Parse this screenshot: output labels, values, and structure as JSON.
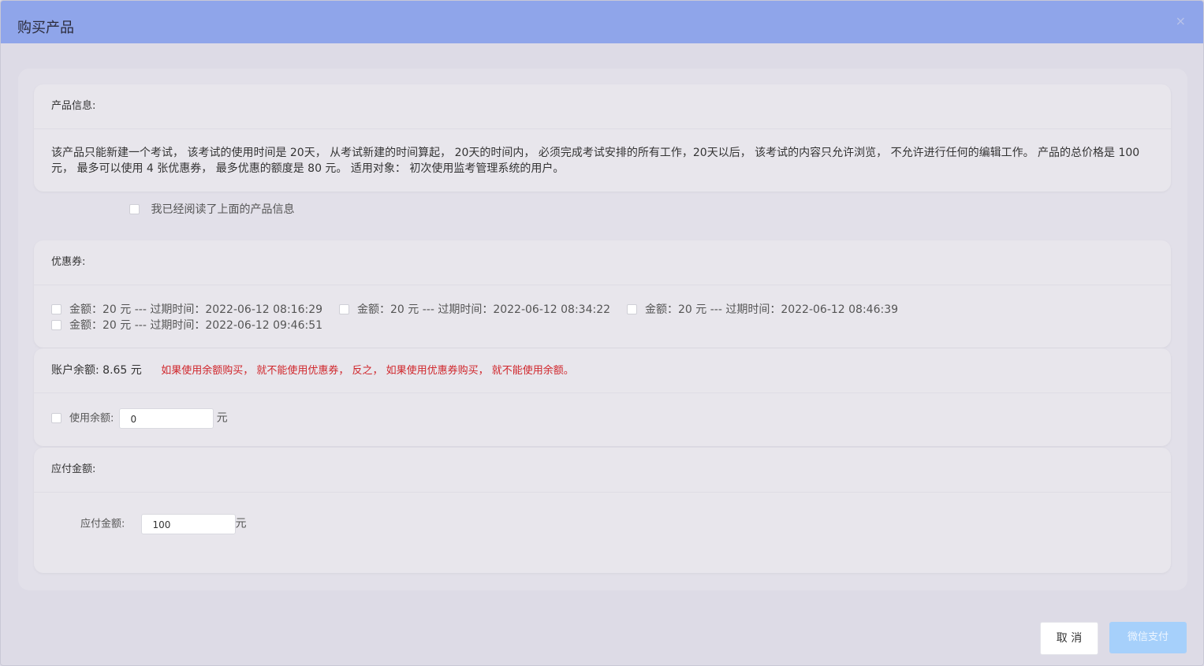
{
  "dialog": {
    "title": "购买产品",
    "close_icon": "×"
  },
  "product_info": {
    "heading": "产品信息:",
    "line1": "该产品只能新建一个考试， 该考试的使用时间是 20天， 从考试新建的时间算起， 20天的时间内， 必须完成考试安排的所有工作，20天以后， 该考试的内容只允许浏览， 不允许进行任何的编辑工作。 产品的总价格是 100",
    "line2": "元， 最多可以使用 4 张优惠券， 最多优惠的额度是 80 元。 适用对象： 初次使用监考管理系统的用户。",
    "read_confirm_label": "我已经阅读了上面的产品信息"
  },
  "coupons": {
    "heading": "优惠券:",
    "items": [
      {
        "label": "金额：20 元 --- 过期时间：2022-06-12 08:16:29"
      },
      {
        "label": "金额：20 元 --- 过期时间：2022-06-12 08:34:22"
      },
      {
        "label": "金额：20 元 --- 过期时间：2022-06-12 08:46:39"
      },
      {
        "label": "金额：20 元 --- 过期时间：2022-06-12 09:46:51"
      }
    ]
  },
  "balance": {
    "heading": "账户余额: 8.65 元",
    "warning": "如果使用余额购买， 就不能使用优惠券， 反之， 如果使用优惠券购买， 就不能使用余额。",
    "warning_color": "#d0262b",
    "use_label": "使用余额:",
    "use_value": "0",
    "unit": "元"
  },
  "payable": {
    "heading": "应付金额:",
    "label": "应付金额:",
    "value": "100",
    "unit": "元"
  },
  "footer": {
    "cancel_label": "取 消",
    "pay_label": "微信支付",
    "pay_color": "#a6d0fb"
  }
}
